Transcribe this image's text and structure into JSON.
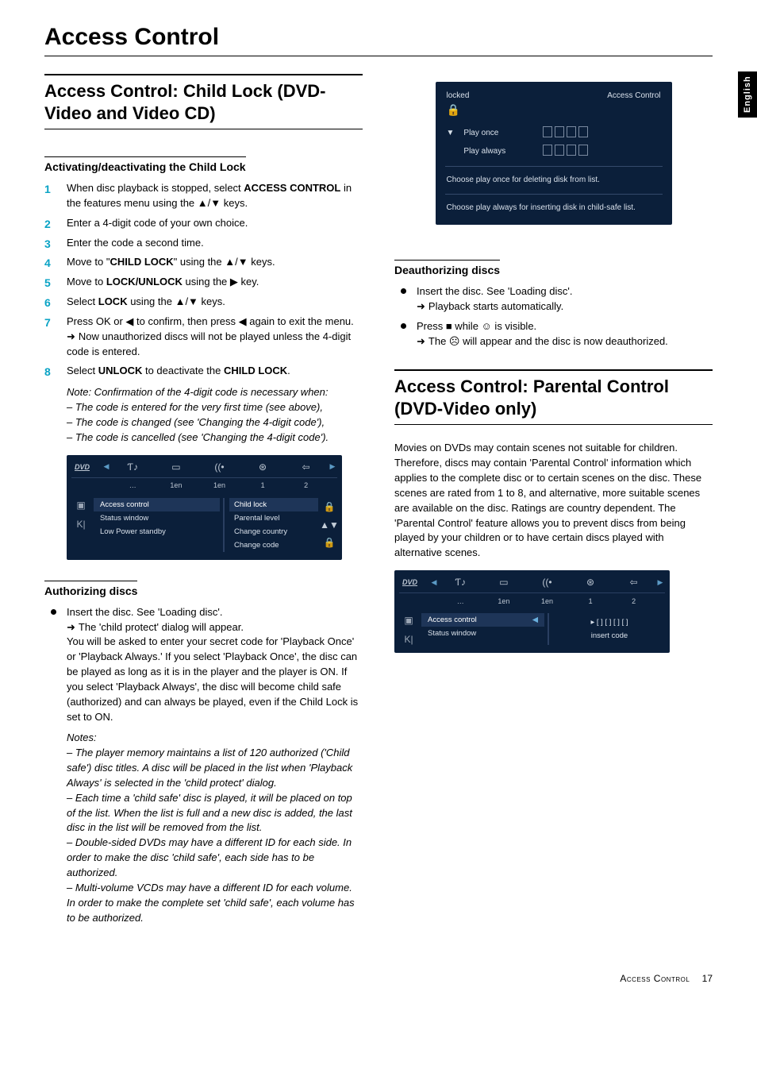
{
  "side_tab": "English",
  "page_title": "Access Control",
  "footer": {
    "label": "Access Control",
    "page": "17"
  },
  "left": {
    "section_title": "Access Control: Child Lock (DVD-Video and Video CD)",
    "sub1": "Activating/deactivating the Child Lock",
    "steps": [
      "When disc playback is stopped, select <b>ACCESS CONTROL</b> in the features menu using the ▲/▼ keys.",
      "Enter a 4-digit code of your own choice.",
      "Enter the code a second time.",
      "Move to \"<b>CHILD LOCK</b>\" using the ▲/▼ keys.",
      "Move to <b>LOCK/UNLOCK</b> using the ▶ key.",
      "Select <b>LOCK</b> using the ▲/▼ keys.",
      "Press OK or ◀ to confirm, then press ◀ again to exit the menu.",
      "Select <b>UNLOCK</b> to deactivate the <b>CHILD LOCK</b>."
    ],
    "step7_follow": "Now unauthorized discs will not be played unless the 4-digit code is entered.",
    "note_lead": "Note: Confirmation of the 4-digit code is necessary when:",
    "note_items": [
      "–   The code is entered for the very first time (see above),",
      "–   The code is changed (see 'Changing the 4-digit code'),",
      "–   The code is cancelled (see 'Changing the 4-digit code')."
    ],
    "osd_nav1": {
      "logo": "DVD",
      "tabs": [
        "…",
        "1en",
        "1en",
        "1",
        "2"
      ],
      "icons": [
        "Ƭ♪",
        "▭",
        "((•",
        "⊛",
        "⇦"
      ],
      "sidebar": [
        "▣",
        "K|"
      ],
      "menu": [
        "Access control",
        "Status window",
        "Low Power standby"
      ],
      "submenu": [
        "Child lock",
        "Parental level",
        "Change country",
        "Change code"
      ],
      "sideicons": [
        "🔒",
        "▲▼",
        "🔒"
      ]
    },
    "sub2": "Authorizing discs",
    "auth_bullet": "Insert the disc. See 'Loading disc'.",
    "auth_follow": "The 'child protect' dialog will appear.",
    "auth_para": "You will be asked to enter your secret code for 'Playback Once' or 'Playback Always.' If you select 'Playback Once', the disc can be played as long as it is in the player and the player is ON. If you select 'Playback Always', the disc will become child safe (authorized) and can always be played, even if the Child Lock is set to ON.",
    "notes_label": "Notes:",
    "notes": [
      "–   The player memory maintains a list of 120 authorized ('Child safe') disc titles. A disc will be placed in the list when 'Playback Always' is selected in the 'child protect' dialog.",
      "–   Each time a 'child safe' disc is played, it will be placed on top of the list. When the list is full and a new disc is added, the last disc in the list will be removed from the list.",
      "–   Double-sided DVDs may have a different ID for each side. In order to make the disc 'child safe', each side has to be authorized.",
      "–   Multi-volume VCDs may have a different ID for each volume. In order to make the complete set 'child safe', each volume has to be authorized."
    ]
  },
  "right": {
    "osd_locked": {
      "status": "locked",
      "title": "Access Control",
      "rows": [
        "Play once",
        "Play always"
      ],
      "foot1": "Choose play once for deleting disk from list.",
      "foot2": "Choose play always for inserting disk in child-safe list."
    },
    "sub1": "Deauthorizing discs",
    "deauth_bullets": [
      "Insert the disc. See 'Loading disc'.",
      "Press ■ while ☺ is visible."
    ],
    "deauth_follow1": "Playback starts automatically.",
    "deauth_follow2": "The ☹ will appear and the disc is now deauthorized.",
    "section_title": "Access Control: Parental Control (DVD-Video only)",
    "para": "Movies on DVDs may contain scenes not suitable for children. Therefore, discs may contain 'Parental Control' information which applies to the complete disc or to certain scenes on the disc. These scenes are rated from 1 to 8, and alternative, more suitable scenes are available on the disc. Ratings are country dependent. The 'Parental Control' feature allows you to prevent discs from being played by your children or to have certain discs played with alternative scenes.",
    "osd_nav2": {
      "logo": "DVD",
      "tabs": [
        "…",
        "1en",
        "1en",
        "1",
        "2"
      ],
      "icons": [
        "Ƭ♪",
        "▭",
        "((•",
        "⊛",
        "⇦"
      ],
      "sidebar": [
        "▣",
        "K|"
      ],
      "menu": [
        "Access control",
        "Status window"
      ],
      "right_box": [
        "▸  [ ]  [ ]  [ ]  [ ]",
        "insert code"
      ]
    }
  }
}
